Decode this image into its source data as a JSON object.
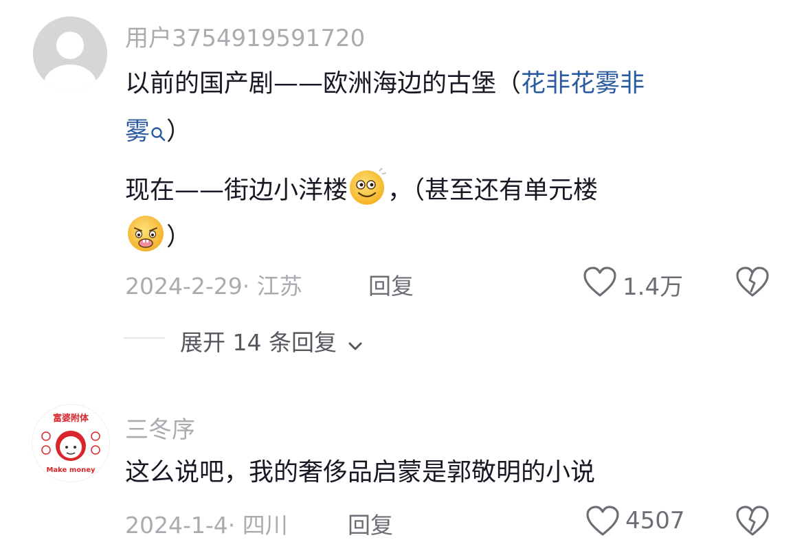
{
  "comments": [
    {
      "username": "用户3754919591720",
      "text_line1_a": "以前的国产剧——欧洲海边的古堡（",
      "text_link_a": "花非花雾非",
      "text_link_b": "雾",
      "text_line2_tail": "）",
      "text_line3": "现在——街边小洋楼",
      "text_line3_b": "，（甚至还有单元楼",
      "text_line4_tail": "）",
      "emoji_1": "smiling-face-emoji",
      "emoji_2": "grimacing-face-emoji",
      "date_location": "2024-2-29· 江苏",
      "reply_label": "回复",
      "likes": "1.4万",
      "expand_label": "展开 14 条回复"
    },
    {
      "username": "三冬序",
      "text": "这么说吧，我的奢侈品启蒙是郭敬明的小说",
      "avatar_text": "富婆附体",
      "avatar_caption": "Make money",
      "date_location": "2024-1-4· 四川",
      "reply_label": "回复",
      "likes": "4507"
    }
  ],
  "colors": {
    "link": "#2a5aa0",
    "meta": "#a9abb0",
    "text": "#161823",
    "avatar_red": "#d8262b"
  },
  "icons": [
    "search-icon",
    "heart-outline-icon",
    "broken-heart-icon",
    "chevron-down-icon"
  ]
}
